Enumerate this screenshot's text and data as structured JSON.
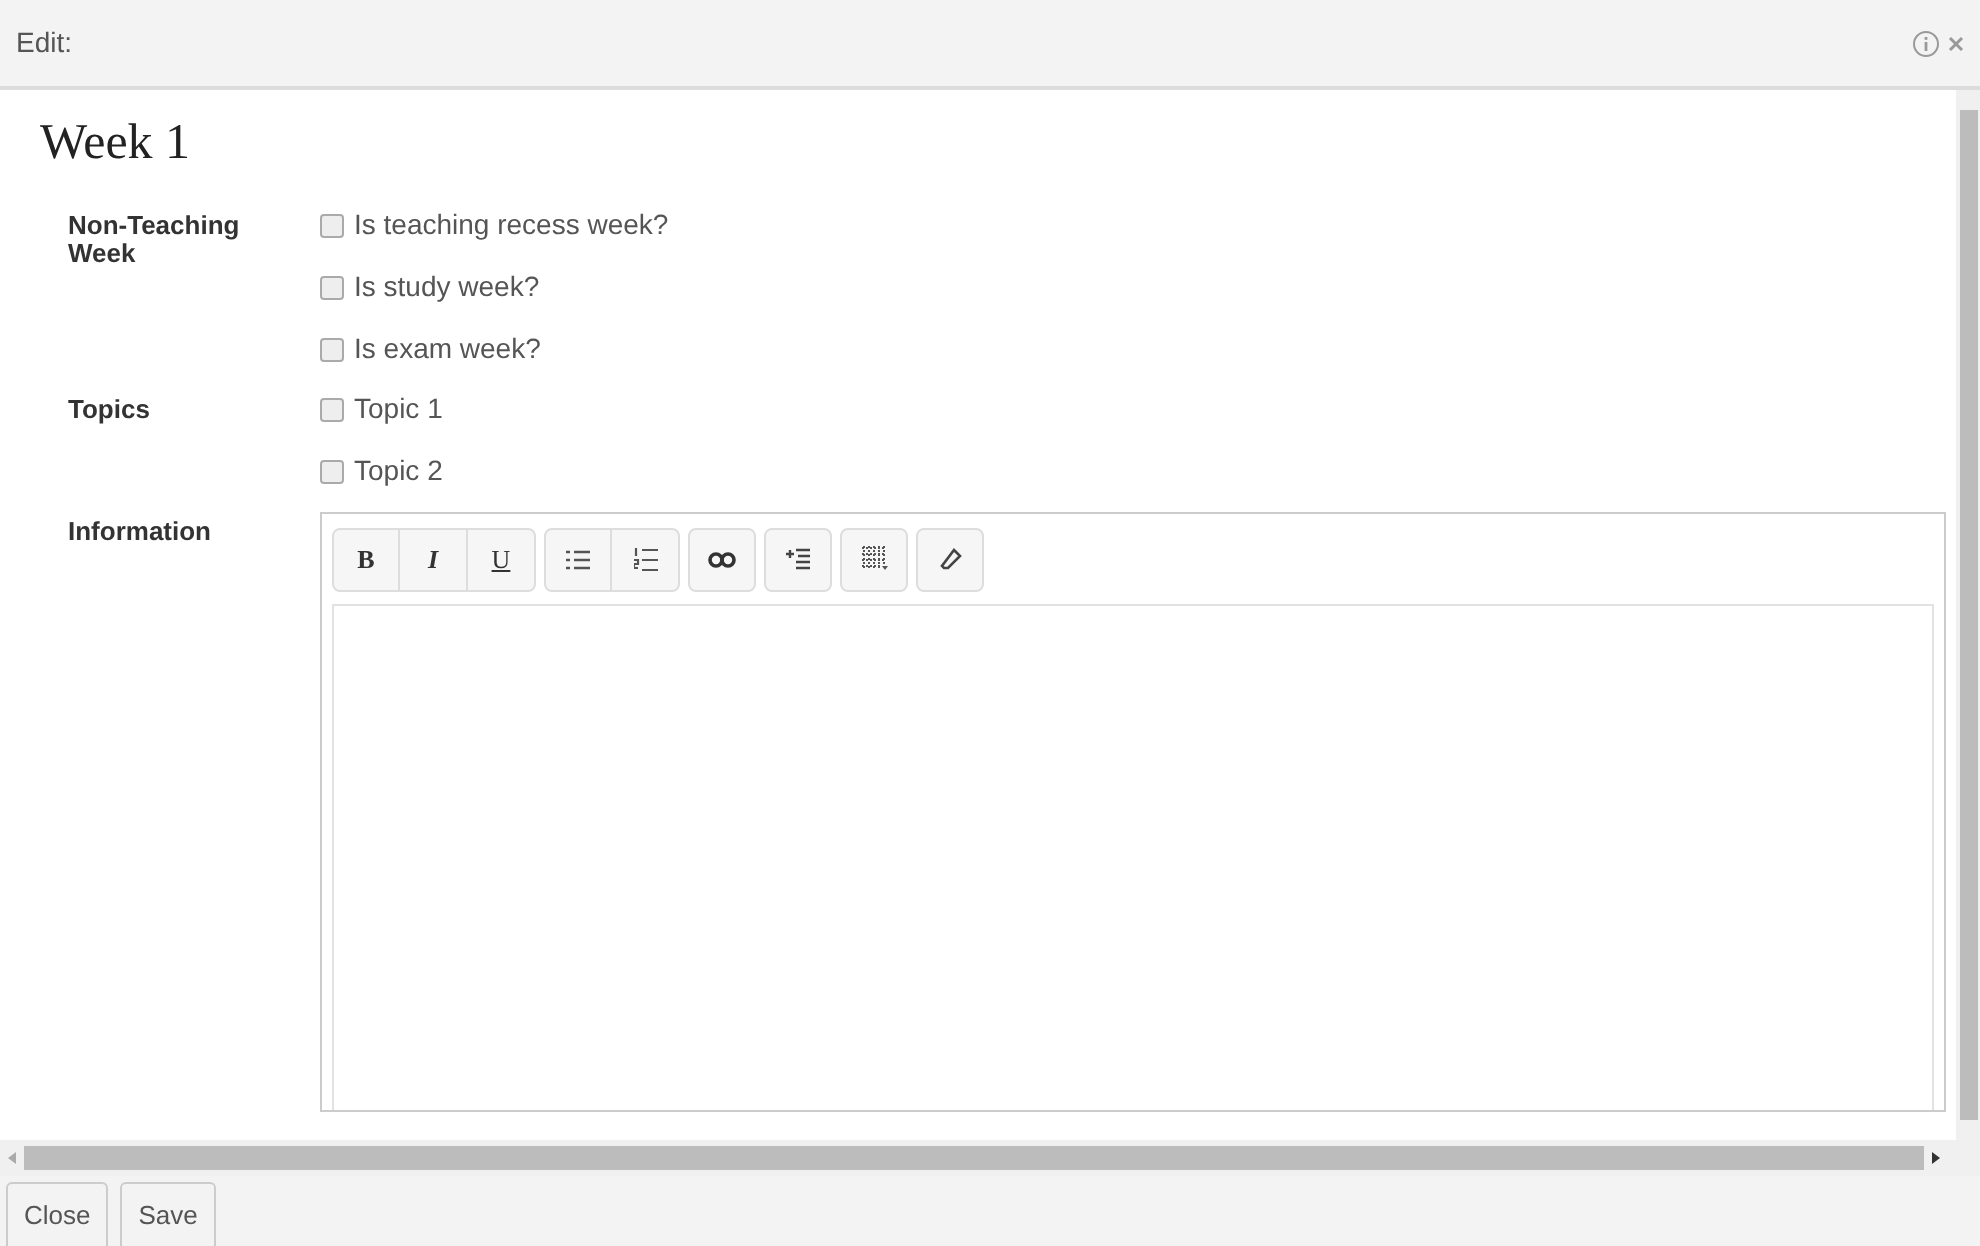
{
  "window": {
    "title": "Edit:"
  },
  "heading": "Week 1",
  "fields": [
    {
      "label": "Non-Teaching Week",
      "kind": "checkboxes",
      "options": [
        {
          "label": "Is teaching recess week?",
          "checked": false
        },
        {
          "label": "Is study week?",
          "checked": false
        },
        {
          "label": "Is exam week?",
          "checked": false
        }
      ]
    },
    {
      "label": "Topics",
      "kind": "checkboxes",
      "options": [
        {
          "label": "Topic 1",
          "checked": false
        },
        {
          "label": "Topic 2",
          "checked": false
        }
      ]
    },
    {
      "label": "Information",
      "kind": "editor",
      "toolbar": [
        [
          {
            "kind": "bold",
            "label": "B"
          },
          {
            "kind": "italic",
            "label": "I"
          },
          {
            "kind": "underline",
            "label": "U"
          }
        ],
        [
          {
            "kind": "bullets"
          },
          {
            "kind": "numbers"
          }
        ],
        [
          {
            "kind": "link"
          }
        ],
        [
          {
            "kind": "indent"
          }
        ],
        [
          {
            "kind": "table"
          }
        ],
        [
          {
            "kind": "eraser"
          }
        ]
      ]
    }
  ],
  "buttons": [
    "Close",
    "Save"
  ]
}
